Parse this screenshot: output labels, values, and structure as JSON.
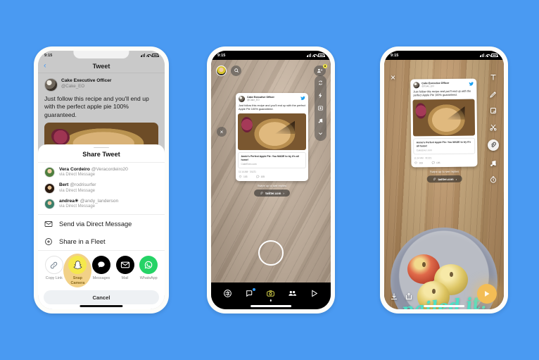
{
  "background_color": "#4a9af2",
  "phones": {
    "phone1": {
      "name": "twitter-share-sheet",
      "status_time": "9:15",
      "header": {
        "title": "Tweet",
        "back_icon": "chevron-left-icon"
      },
      "tweet": {
        "display_name": "Cake Executive Officer",
        "handle": "@Cake_EO",
        "text": "Just follow this recipe and you'll end up with the perfect apple pie 100% guaranteed."
      },
      "sheet": {
        "title": "Share Tweet",
        "contacts": [
          {
            "name": "Vera Cordeiro",
            "handle": "@Veracordeiro20",
            "sub": "via Direct Message"
          },
          {
            "name": "Bert",
            "handle": "@rodrisurfer",
            "sub": "via Direct Message"
          },
          {
            "name": "andrea☀",
            "handle": "@andy_landerson",
            "sub": "via Direct Message"
          }
        ],
        "rows": [
          {
            "label": "Send via Direct Message",
            "icon": "envelope-icon"
          },
          {
            "label": "Share in a Fleet",
            "icon": "plus-circle-icon"
          }
        ],
        "apps": [
          {
            "label": "Copy Link",
            "icon": "link-icon",
            "highlighted": false
          },
          {
            "label": "Snap Camera",
            "icon": "snapchat-ghost-icon",
            "highlighted": true
          },
          {
            "label": "Messages",
            "icon": "messages-bubble-icon",
            "highlighted": false
          },
          {
            "label": "Mail",
            "icon": "mail-envelope-icon",
            "highlighted": false
          },
          {
            "label": "WhatsApp",
            "icon": "whatsapp-icon",
            "highlighted": false
          }
        ],
        "cancel_label": "Cancel"
      }
    },
    "phone2": {
      "name": "snapchat-camera",
      "status_time": "9:15",
      "top_bar": {
        "avatar": "profile-avatar",
        "search_icon": "search-icon",
        "add_friend_icon": "add-friend-icon",
        "add_friend_badge": "8",
        "flip_camera_icon": "flip-camera-icon"
      },
      "side_tools": [
        "flash-icon",
        "timer-icon",
        "music-icon",
        "chevron-down-icon"
      ],
      "close_icon": "close-icon",
      "sticker": {
        "display_name": "Cake Executive Officer",
        "handle": "@Cake_EO",
        "text": "Just follow this recipe and you'll end up with the perfect Apple Pie 100% guaranteed.",
        "link_title": "Annie's Perfect Apple Pie: You MADE to try it's all home!",
        "link_url": "CakeExec.com",
        "meta": "11:14 AM · 3/1/21",
        "likes": "103",
        "replies": "105"
      },
      "swipe_up_label": "Swipe up to see replies",
      "link_pill_label": "twitter.com",
      "shutter": "shutter-button",
      "nav": [
        {
          "icon": "location-map-icon",
          "active": false,
          "badge": false
        },
        {
          "icon": "chat-icon",
          "active": false,
          "badge": true
        },
        {
          "icon": "camera-icon",
          "active": true,
          "badge": false
        },
        {
          "icon": "friends-icon",
          "active": false,
          "badge": false
        },
        {
          "icon": "play-spotlight-icon",
          "active": false,
          "badge": false
        }
      ]
    },
    "phone3": {
      "name": "snapchat-editor",
      "status_time": "9:15",
      "close_icon": "close-icon",
      "tools": [
        {
          "icon": "text-tool-icon",
          "selected": false
        },
        {
          "icon": "pencil-draw-icon",
          "selected": false
        },
        {
          "icon": "sticker-icon",
          "selected": false
        },
        {
          "icon": "scissors-icon",
          "selected": false
        },
        {
          "icon": "paperclip-attach-icon",
          "selected": true
        },
        {
          "icon": "music-icon",
          "selected": false
        },
        {
          "icon": "timer-icon",
          "selected": false
        }
      ],
      "sticker": {
        "display_name": "Cake Executive Officer",
        "handle": "@Cake_EO",
        "text": "Just follow this recipe and you'll end up with the perfect Apple Pie 100% guaranteed.",
        "link_title": "Annie's Perfect Apple Pie: You MADE to try it's all home!",
        "link_url": "CakeExec.com",
        "meta": "11:14 AM · 3/1/21",
        "likes": "103",
        "replies": "105"
      },
      "swipe_up_label": "Swipe up to see replies",
      "link_pill_label": "twitter.com",
      "caption": "nailed it.",
      "caption_color": "#4ee0c6",
      "bottom_icons": [
        {
          "icon": "download-save-icon"
        },
        {
          "icon": "add-to-story-icon"
        }
      ],
      "send_icon": "send-arrow-icon"
    }
  }
}
